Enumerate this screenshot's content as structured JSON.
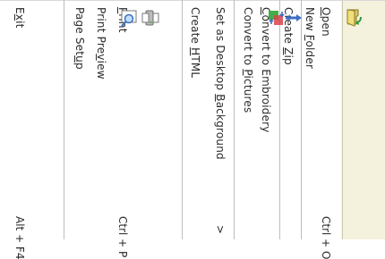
{
  "menu": {
    "items": [
      {
        "pre": "",
        "key": "O",
        "post": "pen",
        "shortcut": "Ctrl + O",
        "icon": "open-folder-icon"
      },
      {
        "pre": "New ",
        "key": "F",
        "post": "older",
        "shortcut": "",
        "icon": ""
      },
      {
        "pre": "Create ",
        "key": "Z",
        "post": "ip",
        "shortcut": "",
        "icon": ""
      },
      {
        "pre": "",
        "key": "C",
        "post": "onvert to Embroidery",
        "shortcut": "",
        "icon": "convert-embroidery-icon"
      },
      {
        "pre": "Convert to ",
        "key": "P",
        "post": "ictures",
        "shortcut": "",
        "icon": "convert-pictures-icon"
      },
      {
        "pre": "Set as Desktop ",
        "key": "B",
        "post": "ackground",
        "shortcut": "",
        "arrow": ">",
        "icon": ""
      },
      {
        "pre": "Create ",
        "key": "H",
        "post": "TML",
        "shortcut": "",
        "icon": ""
      },
      {
        "pre": "",
        "key": "P",
        "post": "rint",
        "shortcut": "Ctrl + P",
        "icon": "printer-icon"
      },
      {
        "pre": "Print Pre",
        "key": "v",
        "post": "iew",
        "shortcut": "",
        "icon": "print-preview-icon"
      },
      {
        "pre": "Page Set",
        "key": "u",
        "post": "p",
        "shortcut": "",
        "icon": ""
      },
      {
        "pre": "E",
        "key": "x",
        "post": "it",
        "shortcut": "Alt + F4",
        "icon": ""
      }
    ]
  },
  "colors": {
    "icon_strip": "#f4f1dc",
    "separator": "#bdbdbd",
    "text": "#2b2b2b"
  }
}
